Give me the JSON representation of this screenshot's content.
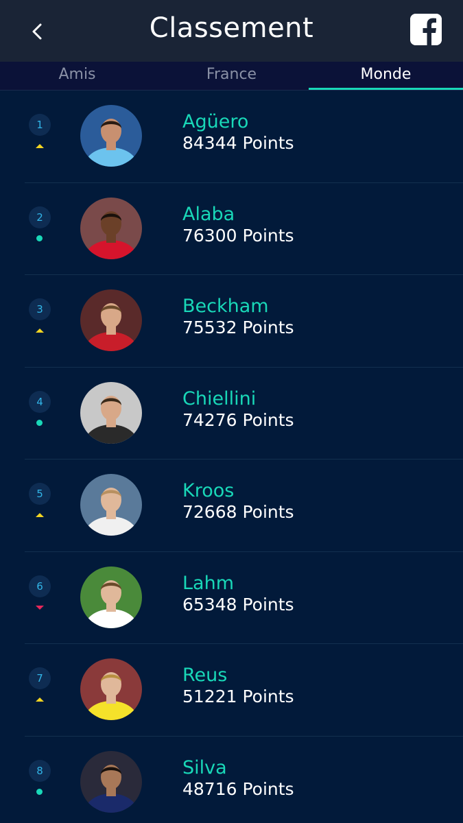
{
  "header": {
    "title": "Classement",
    "back_icon": "chevron-left-icon",
    "share_icon": "facebook-icon"
  },
  "tabs": [
    {
      "label": "Amis",
      "active": false
    },
    {
      "label": "France",
      "active": false
    },
    {
      "label": "Monde",
      "active": true
    }
  ],
  "colors": {
    "background": "#021a3a",
    "header": "#1a2436",
    "tabs_bar": "#0b1238",
    "accent": "#19d8b8",
    "trend_up": "#f2d522",
    "trend_down": "#e8275a",
    "rank_text": "#32b6e8"
  },
  "ranking": [
    {
      "rank": "1",
      "trend": "up",
      "name": "Agüero",
      "points": "84344 Points",
      "kit": {
        "bg": "#2b5c9a",
        "shirt": "#6cc3ee",
        "skin": "#c89070",
        "hair": "#2a1b12"
      }
    },
    {
      "rank": "2",
      "trend": "same",
      "name": "Alaba",
      "points": "76300 Points",
      "kit": {
        "bg": "#7a4a4a",
        "shirt": "#d6142c",
        "skin": "#6b4028",
        "hair": "#1a110c"
      }
    },
    {
      "rank": "3",
      "trend": "up",
      "name": "Beckham",
      "points": "75532 Points",
      "kit": {
        "bg": "#5a2a2a",
        "shirt": "#c81e2a",
        "skin": "#d8a888",
        "hair": "#6a4a2a"
      }
    },
    {
      "rank": "4",
      "trend": "same",
      "name": "Chiellini",
      "points": "74276 Points",
      "kit": {
        "bg": "#c8c8c8",
        "shirt": "#2a2a2a",
        "skin": "#d8a888",
        "hair": "#3a2a1a"
      }
    },
    {
      "rank": "5",
      "trend": "up",
      "name": "Kroos",
      "points": "72668 Points",
      "kit": {
        "bg": "#5a7a9a",
        "shirt": "#f0f0f0",
        "skin": "#e0b89a",
        "hair": "#b89060"
      }
    },
    {
      "rank": "6",
      "trend": "down",
      "name": "Lahm",
      "points": "65348 Points",
      "kit": {
        "bg": "#4a8a3a",
        "shirt": "#ffffff",
        "skin": "#e0b89a",
        "hair": "#6a4a2a"
      }
    },
    {
      "rank": "7",
      "trend": "up",
      "name": "Reus",
      "points": "51221 Points",
      "kit": {
        "bg": "#8a3a3a",
        "shirt": "#f5e22a",
        "skin": "#e0b89a",
        "hair": "#b89040"
      }
    },
    {
      "rank": "8",
      "trend": "same",
      "name": "Silva",
      "points": "48716 Points",
      "kit": {
        "bg": "#2a2a3a",
        "shirt": "#1a2a6a",
        "skin": "#a87858",
        "hair": "#1a110c"
      }
    }
  ]
}
